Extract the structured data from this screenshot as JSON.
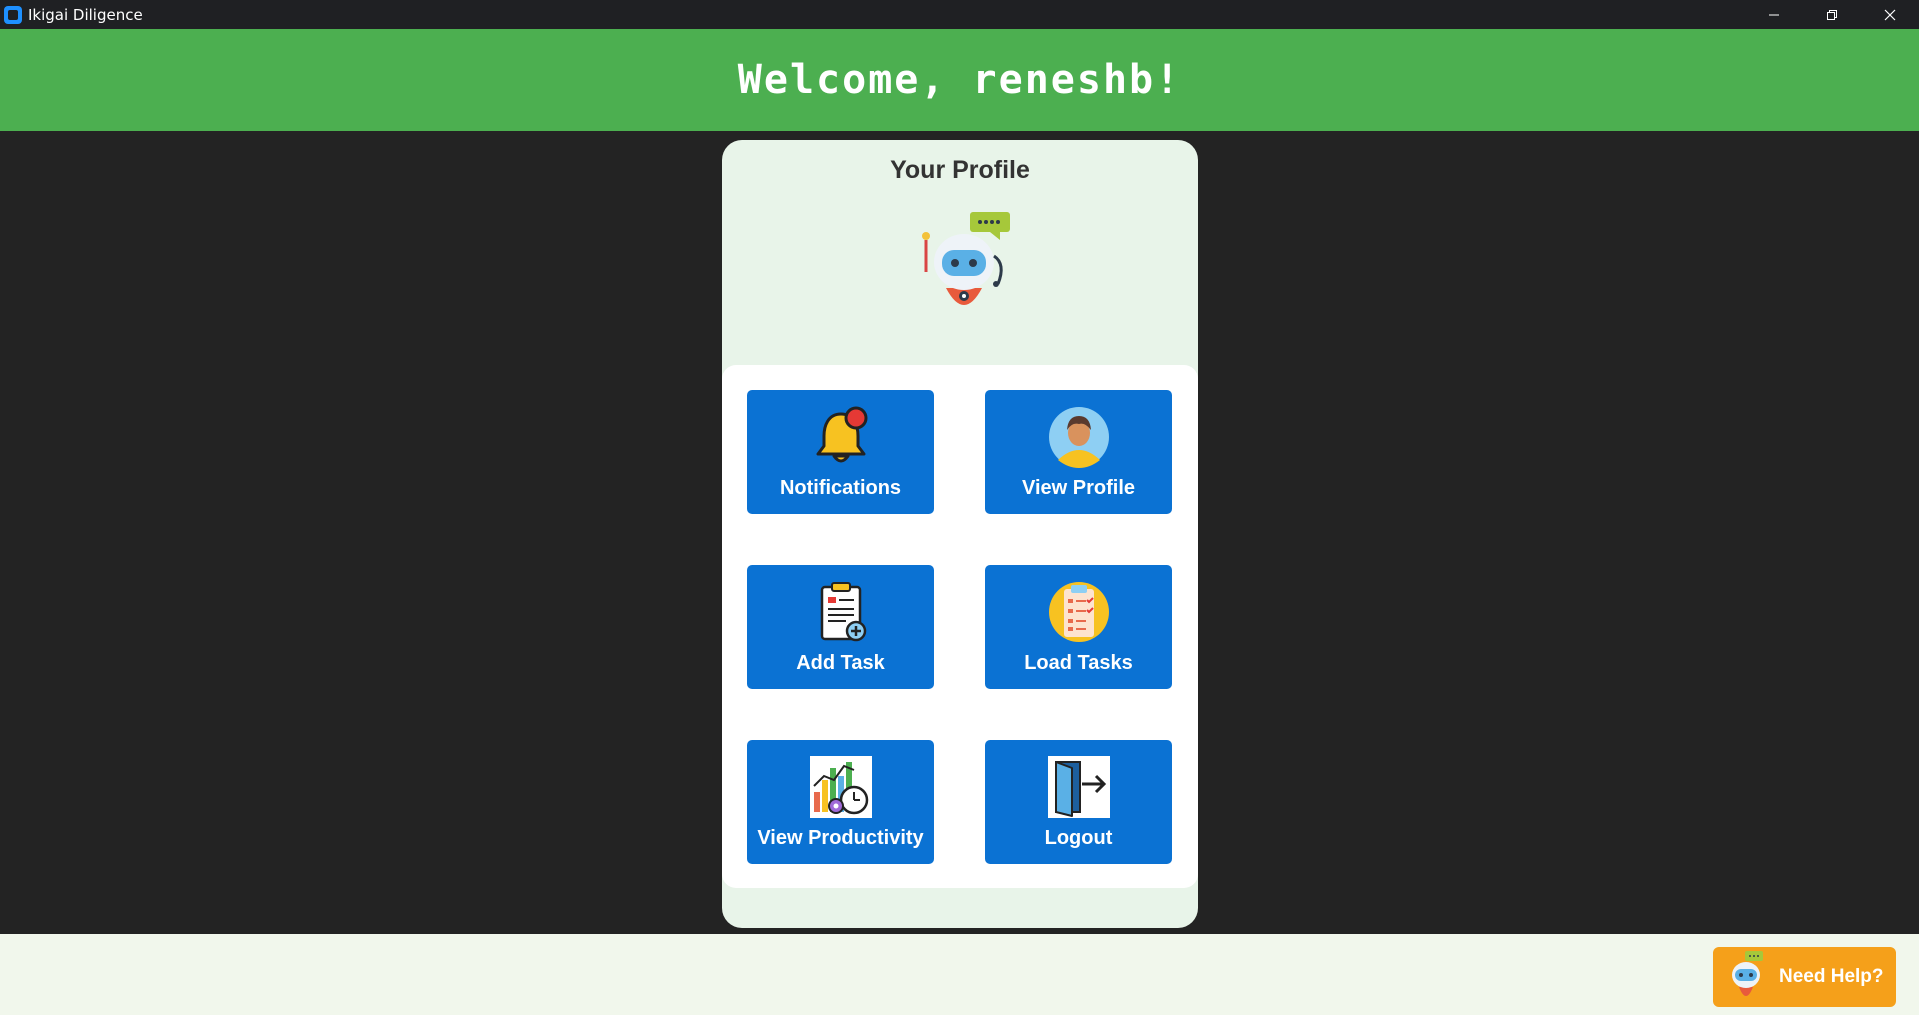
{
  "window": {
    "title": "Ikigai Diligence",
    "icon": "app-icon",
    "controls": [
      "minimize-icon",
      "restore-icon",
      "close-icon"
    ]
  },
  "header": {
    "welcome_text": "Welcome, reneshb!",
    "background_color": "#4caf50"
  },
  "profile": {
    "title": "Your Profile",
    "avatar_icon": "robot-icon"
  },
  "tiles": [
    {
      "label": "Notifications",
      "icon": "bell-icon"
    },
    {
      "label": "View Profile",
      "icon": "user-avatar-icon"
    },
    {
      "label": "Add Task",
      "icon": "clipboard-add-icon"
    },
    {
      "label": "Load Tasks",
      "icon": "checklist-icon"
    },
    {
      "label": "View Productivity",
      "icon": "productivity-chart-icon"
    },
    {
      "label": "Logout",
      "icon": "logout-door-icon"
    }
  ],
  "help": {
    "label": "Need Help?",
    "icon": "robot-icon",
    "color": "#f5a01a"
  },
  "colors": {
    "tile": "#0b72d3",
    "card": "#e8f4e9"
  }
}
